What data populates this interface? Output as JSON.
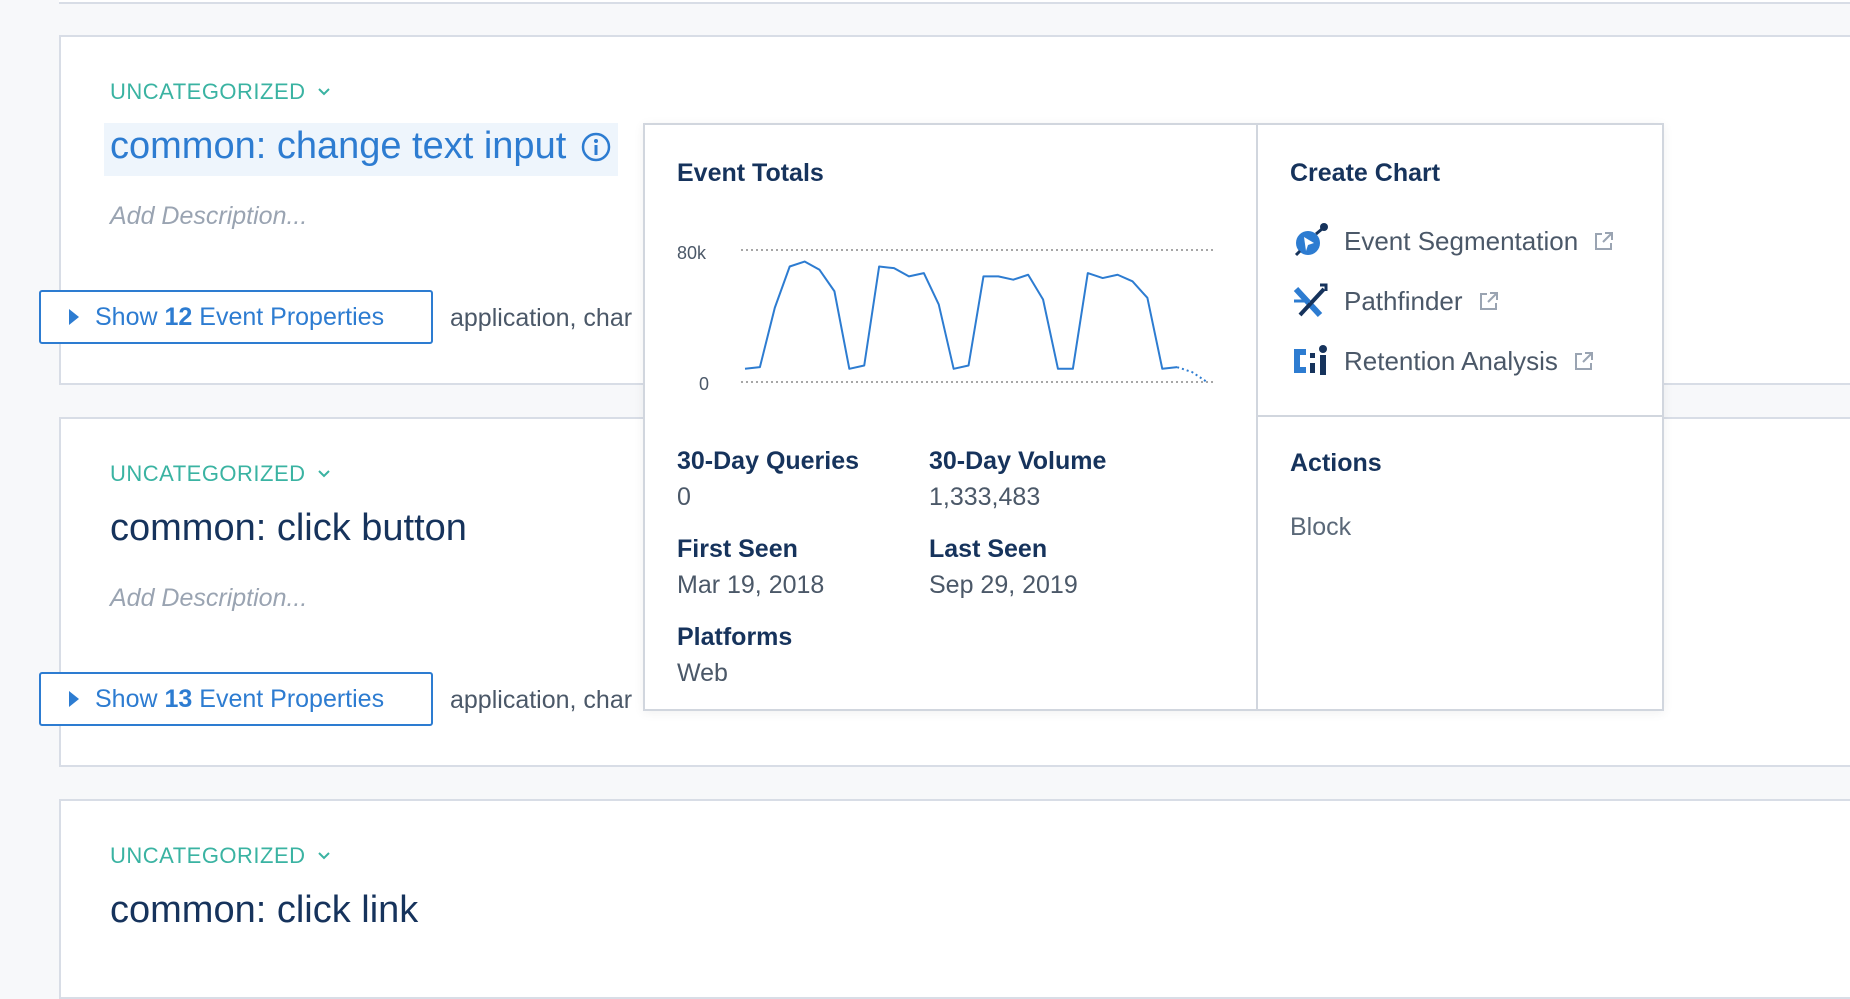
{
  "events": [
    {
      "category": "UNCATEGORIZED",
      "title": "common: change text input",
      "description_placeholder": "Add Description...",
      "show_props": {
        "prefix": "Show",
        "count": "12",
        "suffix": "Event Properties"
      },
      "props_preview": "application, char"
    },
    {
      "category": "UNCATEGORIZED",
      "title": "common: click button",
      "description_placeholder": "Add Description...",
      "show_props": {
        "prefix": "Show",
        "count": "13",
        "suffix": "Event Properties"
      },
      "props_preview": "application, char"
    },
    {
      "category": "UNCATEGORIZED",
      "title": "common: click link"
    }
  ],
  "popover": {
    "event_totals_title": "Event Totals",
    "chart_data": {
      "type": "line",
      "ylim": [
        0,
        80000
      ],
      "ytick_labels": [
        "80k",
        "0"
      ],
      "values": [
        8000,
        9000,
        45000,
        70000,
        73000,
        68000,
        55000,
        8000,
        10000,
        70000,
        69000,
        64000,
        66000,
        47000,
        8000,
        10000,
        64000,
        64000,
        62000,
        65000,
        50000,
        8000,
        8000,
        66000,
        63000,
        65000,
        61000,
        51000,
        8000,
        9000,
        6000,
        0
      ]
    },
    "stats": {
      "queries_label": "30-Day Queries",
      "queries_value": "0",
      "volume_label": "30-Day Volume",
      "volume_value": "1,333,483",
      "first_seen_label": "First Seen",
      "first_seen_value": "Mar 19, 2018",
      "last_seen_label": "Last Seen",
      "last_seen_value": "Sep 29, 2019",
      "platforms_label": "Platforms",
      "platforms_value": "Web"
    },
    "create_chart_title": "Create Chart",
    "links": [
      {
        "label": "Event Segmentation",
        "icon": "event-segmentation-icon"
      },
      {
        "label": "Pathfinder",
        "icon": "pathfinder-icon"
      },
      {
        "label": "Retention Analysis",
        "icon": "retention-analysis-icon"
      }
    ],
    "actions_title": "Actions",
    "actions": [
      "Block"
    ]
  },
  "colors": {
    "accent": "#2d7cd1",
    "category": "#3ab3a2",
    "title": "#16335c",
    "line": "#2d7cd1"
  }
}
